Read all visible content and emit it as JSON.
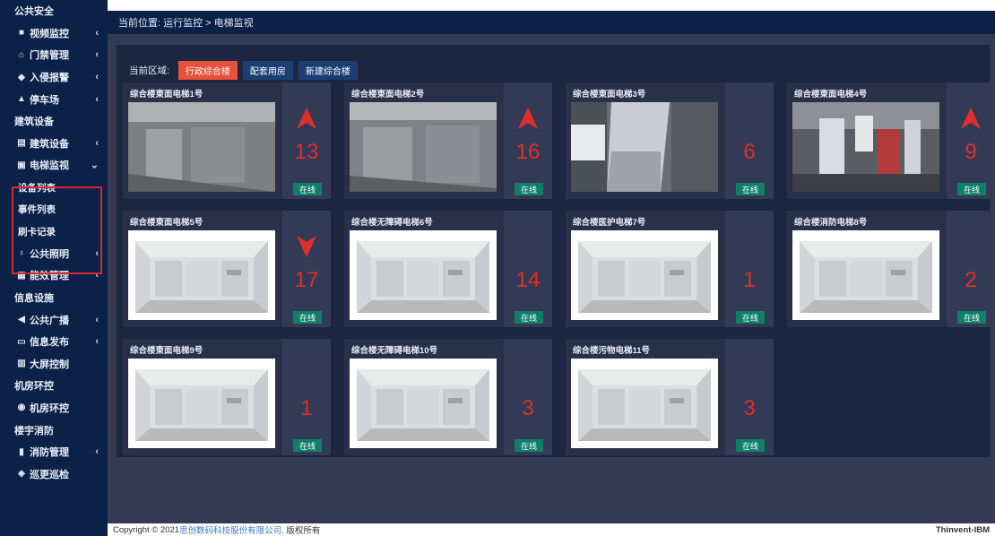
{
  "sidebar": {
    "items": [
      {
        "label": "公共安全",
        "icon": "",
        "section": true
      },
      {
        "label": "视频监控",
        "icon": "video-icon",
        "chevron": true
      },
      {
        "label": "门禁管理",
        "icon": "door-icon",
        "chevron": true
      },
      {
        "label": "入侵报警",
        "icon": "shield-icon",
        "chevron": true
      },
      {
        "label": "停车场",
        "icon": "car-icon",
        "chevron": true
      },
      {
        "label": "建筑设备",
        "icon": "",
        "section": true
      },
      {
        "label": "建筑设备",
        "icon": "building-icon",
        "chevron": true
      },
      {
        "label": "电梯监视",
        "icon": "elevator-icon",
        "chevron": true,
        "expanded": true
      },
      {
        "label": "设备列表",
        "sub": true
      },
      {
        "label": "事件列表",
        "sub": true
      },
      {
        "label": "刷卡记录",
        "sub": true
      },
      {
        "label": "公共照明",
        "icon": "bulb-icon",
        "chevron": true
      },
      {
        "label": "能效管理",
        "icon": "meter-icon",
        "chevron": true
      },
      {
        "label": "信息设施",
        "icon": "",
        "section": true
      },
      {
        "label": "公共广播",
        "icon": "broadcast-icon",
        "chevron": true
      },
      {
        "label": "信息发布",
        "icon": "monitor-icon",
        "chevron": true
      },
      {
        "label": "大屏控制",
        "icon": "grid-icon"
      },
      {
        "label": "机房环控",
        "icon": "",
        "section": true
      },
      {
        "label": "机房环控",
        "icon": "server-icon"
      },
      {
        "label": "楼宇消防",
        "icon": "",
        "section": true
      },
      {
        "label": "消防管理",
        "icon": "extinguisher-icon",
        "chevron": true
      },
      {
        "label": "巡更巡检",
        "icon": "patrol-icon"
      }
    ]
  },
  "header": {
    "breadcrumb": "当前位置: 运行监控 > 电梯监视"
  },
  "areas": {
    "label": "当前区域:",
    "buttons": [
      "行政综合楼",
      "配套用房",
      "新建综合楼"
    ],
    "active": 0
  },
  "elevators": [
    {
      "name": "综合楼東面电梯1号",
      "floor": "13",
      "direction": "up",
      "status": "在线",
      "image": "camera"
    },
    {
      "name": "综合楼東面电梯2号",
      "floor": "16",
      "direction": "up",
      "status": "在线",
      "image": "camera"
    },
    {
      "name": "综合楼東面电梯3号",
      "floor": "6",
      "direction": "none",
      "status": "在线",
      "image": "camera"
    },
    {
      "name": "综合楼東面电梯4号",
      "floor": "9",
      "direction": "up",
      "status": "在线",
      "image": "camera"
    },
    {
      "name": "综合楼東面电梯5号",
      "floor": "17",
      "direction": "down",
      "status": "在线",
      "image": "cabin"
    },
    {
      "name": "综合楼无障碍电梯6号",
      "floor": "14",
      "direction": "none",
      "status": "在线",
      "image": "cabin"
    },
    {
      "name": "综合楼医护电梯7号",
      "floor": "1",
      "direction": "none",
      "status": "在线",
      "image": "cabin"
    },
    {
      "name": "综合楼消防电梯8号",
      "floor": "2",
      "direction": "none",
      "status": "在线",
      "image": "cabin"
    },
    {
      "name": "综合楼東面电梯9号",
      "floor": "1",
      "direction": "none",
      "status": "在线",
      "image": "cabin"
    },
    {
      "name": "综合楼无障碍电梯10号",
      "floor": "3",
      "direction": "none",
      "status": "在线",
      "image": "cabin"
    },
    {
      "name": "综合楼污物电梯11号",
      "floor": "3",
      "direction": "none",
      "status": "在线",
      "image": "cabin"
    }
  ],
  "footer": {
    "copyright": "Copyright © 2021 ",
    "company": "思创数码科技股份有限公司",
    "rights": ". 版权所有",
    "brand": "Thinvent-IBM"
  },
  "colors": {
    "sidebar": "#0c2148",
    "accent": "#e84f3d",
    "online": "#0f7f6a",
    "floor": "#e02f2b"
  }
}
